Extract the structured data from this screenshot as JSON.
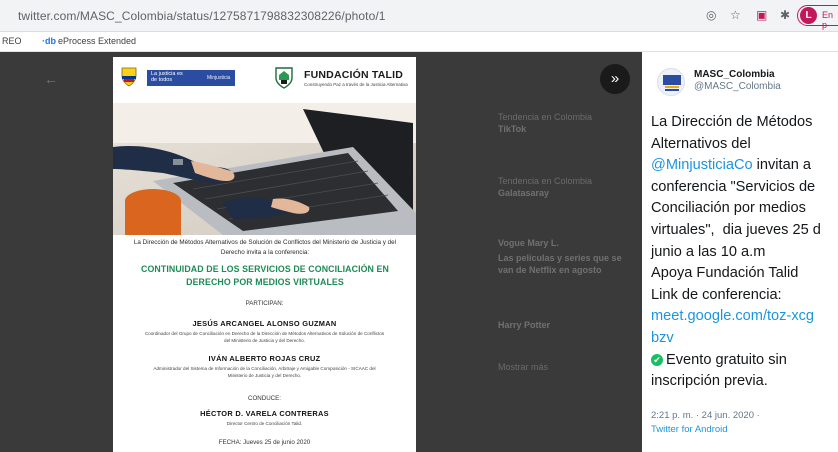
{
  "browser": {
    "url": "twitter.com/MASC_Colombia/status/1275871798832308226/photo/1",
    "icons": [
      "target-icon",
      "star-icon",
      "shield-ext-icon",
      "puzzle-icon"
    ],
    "profile_initial": "L",
    "profile_label": "En p",
    "bookmarks": [
      {
        "label": "REO"
      },
      {
        "icon": "eprocess-icon",
        "icon_text": "·db",
        "label": "eProcess Extended"
      }
    ]
  },
  "viewer": {
    "prev_label": "←",
    "next_label": "»"
  },
  "poster": {
    "gov_logo_text": "La justicia es de todos",
    "gov_logo_sub": "Minjusticia",
    "org_title": "FUNDACIÓN TALID",
    "org_subtitle": "Construyendo Paz a través de la Justicia Alternativa",
    "intro": "La Dirección de Métodos Alternativos de Solución de Conflictos del Ministerio de Justicia y del Derecho invita a la conferencia:",
    "headline": "CONTINUIDAD DE LOS SERVICIOS DE CONCILIACIÓN EN DERECHO POR MEDIOS VIRTUALES",
    "participan": "PARTICIPAN:",
    "speakers": [
      {
        "name": "JESÚS ARCANGEL ALONSO GUZMAN",
        "role": "Coordinador del Grupo de Conciliación en Derecho de la Dirección de Métodos Alternativos de Solución de Conflictos del Ministerio de Justicia y del Derecho."
      },
      {
        "name": "IVÁN ALBERTO ROJAS CRUZ",
        "role": "Administrador del Sistema de Información de la Conciliación, Arbitraje y Amigable Composición - SICAAC del Ministerio de Justicia y del Derecho."
      }
    ],
    "conduce": "CONDUCE:",
    "host": {
      "name": "HÉCTOR D. VARELA CONTRERAS",
      "role": "Director Centro de Conciliación Talid."
    },
    "fecha": "FECHA: Jueves 25 de junio 2020"
  },
  "tweet": {
    "display_name": "MASC_Colombia",
    "handle": "@MASC_Colombia",
    "text_1": "La Dirección de Métodos\nAlternativos del\n",
    "mention": "@MinjusticiaCo",
    "text_2": " invitan a\nconferencia \"Servicios de\nConciliación por medios\nvirtuales\",  dia jueves 25 d\njunio a las 10 a.m\nApoya Fundación Talid\nLink de conferencia:\n",
    "link": "meet.google.com/toz-xcg\nbzv",
    "text_3": "Evento gratuito sin\ninscripción previa.",
    "check_glyph": "✔",
    "timestamp": "2:21 p. m. · 24 jun. 2020 ·",
    "source": "Twitter for Android"
  },
  "background_feed": {
    "items": [
      {
        "text": "Tendencia en Colombia",
        "bold": false
      },
      {
        "text": "TikTok",
        "bold": true
      },
      {
        "text": "Tendencia en Colombia",
        "bold": false
      },
      {
        "text": "Galatasaray",
        "bold": true
      },
      {
        "text": "Vogue Mary L.",
        "bold": true
      },
      {
        "text": "Las películas y series que se van de Netflix en agosto",
        "bold": true
      },
      {
        "text": "Harry Potter",
        "bold": true
      },
      {
        "text": "Mostrar más",
        "bold": false
      }
    ]
  }
}
